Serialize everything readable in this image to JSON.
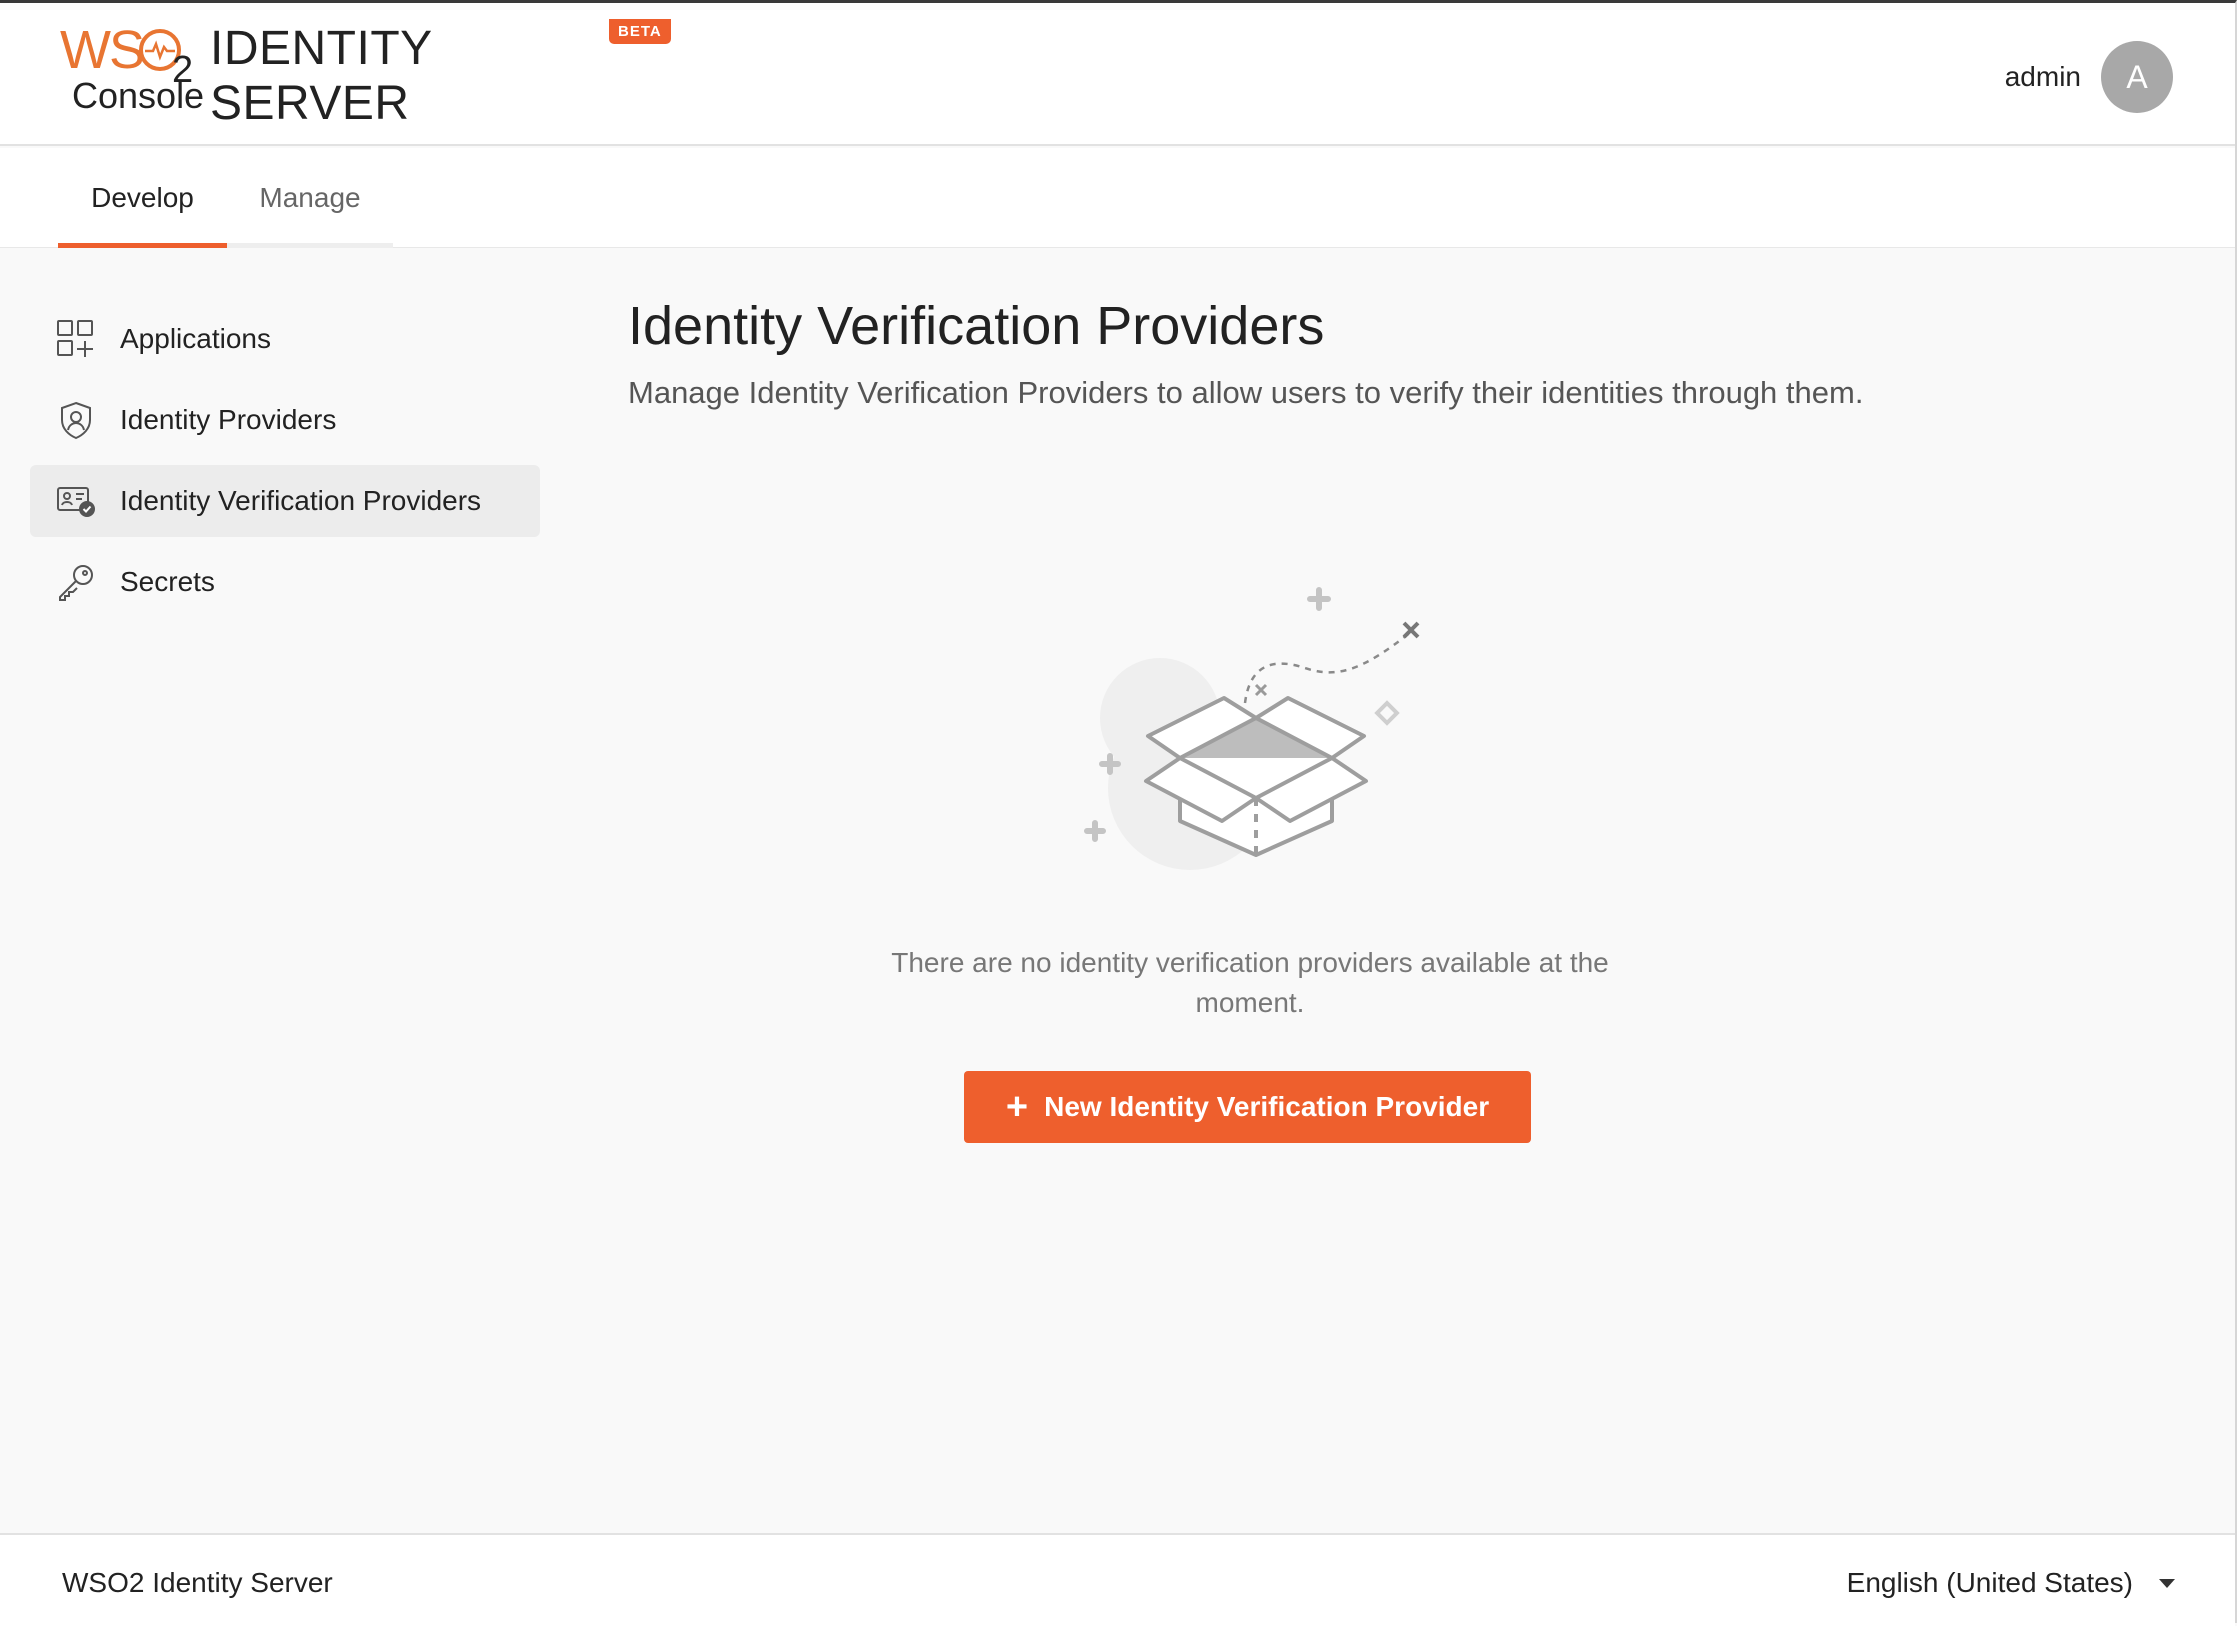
{
  "header": {
    "logo_wso": "WS",
    "logo_sub": "2",
    "product_name": "IDENTITY SERVER",
    "console_label": "Console",
    "beta_badge": "BETA",
    "user_name": "admin",
    "avatar_initial": "A"
  },
  "tabs": [
    {
      "label": "Develop",
      "active": true
    },
    {
      "label": "Manage",
      "active": false
    }
  ],
  "sidebar": {
    "items": [
      {
        "label": "Applications",
        "icon": "applications-icon",
        "active": false
      },
      {
        "label": "Identity Providers",
        "icon": "identity-providers-icon",
        "active": false
      },
      {
        "label": "Identity Verification Providers",
        "icon": "id-card-verified-icon",
        "active": true
      },
      {
        "label": "Secrets",
        "icon": "key-icon",
        "active": false
      }
    ]
  },
  "main": {
    "title": "Identity Verification Providers",
    "description": "Manage Identity Verification Providers to allow users to verify their identities through them.",
    "empty_message_line1": "There are no identity verification providers available at the",
    "empty_message_line2": "moment.",
    "new_button_label": "New Identity Verification Provider",
    "illustration": "empty-box-illustration"
  },
  "footer": {
    "brand": "WSO2 Identity Server",
    "language": "English (United States)"
  },
  "colors": {
    "accent": "#ee5f2d",
    "logo_orange": "#e87532"
  }
}
